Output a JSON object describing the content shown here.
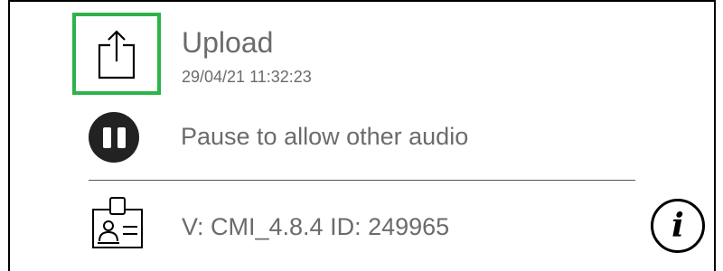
{
  "upload": {
    "icon": "share-upload-icon",
    "title": "Upload",
    "timestamp": "29/04/21 11:32:23"
  },
  "pause": {
    "icon": "pause-icon",
    "label": "Pause to allow other audio"
  },
  "version": {
    "icon": "id-badge-icon",
    "text": "V: CMI_4.8.4 ID: 249965"
  },
  "info": {
    "icon": "info-icon",
    "glyph": "i"
  },
  "colors": {
    "highlight": "#2db34a",
    "text": "#6b6b6b",
    "pause_bg": "#222222"
  }
}
